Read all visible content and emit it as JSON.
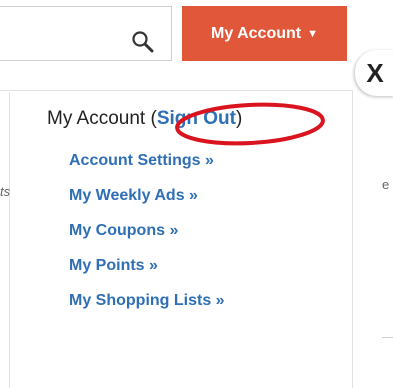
{
  "search": {
    "icon": "search-icon"
  },
  "account_button": {
    "label": "My Account",
    "caret": "▼",
    "color": "#e0573a"
  },
  "close": {
    "label": "X"
  },
  "background_fragments": {
    "left": "ts",
    "right": "e"
  },
  "dropdown": {
    "title": "My Account",
    "open_paren": "(",
    "sign_out": "Sign Out",
    "close_paren": ")",
    "items": [
      {
        "label": "Account Settings »"
      },
      {
        "label": "My Weekly Ads »"
      },
      {
        "label": "My Coupons »"
      },
      {
        "label": "My Points »"
      },
      {
        "label": "My Shopping Lists »"
      }
    ],
    "link_color": "#2f6fb5",
    "highlight_color": "#d9141f"
  }
}
